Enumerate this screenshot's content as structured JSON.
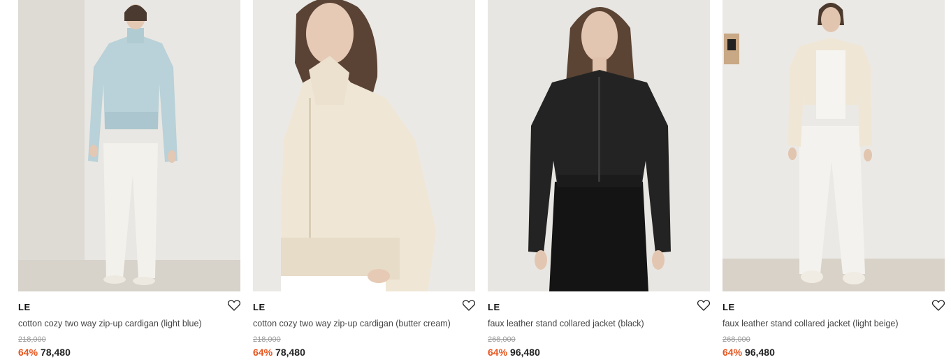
{
  "products": [
    {
      "brand": "LE",
      "name": "cotton cozy two way zip-up cardigan (light blue)",
      "original_price": "218,000",
      "discount": "64%",
      "sale_price": "78,480",
      "image_desc_icon": "product-photo"
    },
    {
      "brand": "LE",
      "name": "cotton cozy two way zip-up cardigan (butter cream)",
      "original_price": "218,000",
      "discount": "64%",
      "sale_price": "78,480",
      "image_desc_icon": "product-photo"
    },
    {
      "brand": "LE",
      "name": "faux leather stand collared jacket (black)",
      "original_price": "268,000",
      "discount": "64%",
      "sale_price": "96,480",
      "image_desc_icon": "product-photo"
    },
    {
      "brand": "LE",
      "name": "faux leather stand collared jacket (light beige)",
      "original_price": "268,000",
      "discount": "64%",
      "sale_price": "96,480",
      "image_desc_icon": "product-photo"
    }
  ],
  "colors": {
    "discount": "#e8541c",
    "strike": "#9a9a9a",
    "text": "#222222"
  },
  "icons": {
    "wishlist": "heart-outline-icon"
  }
}
